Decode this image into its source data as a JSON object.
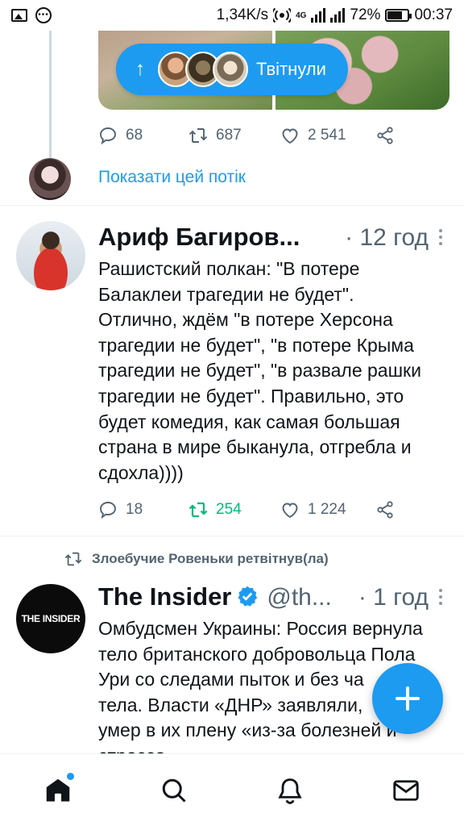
{
  "status_bar": {
    "speed": "1,34K/s",
    "network": "4G",
    "battery": "72%",
    "time": "00:37",
    "icons": [
      "image-icon",
      "more-dots-icon",
      "hotspot-icon",
      "signal-icon",
      "battery-icon"
    ]
  },
  "colors": {
    "accent": "#1d9bf0",
    "retweet_active": "#00ba7c",
    "muted": "#536471",
    "text": "#0f1419"
  },
  "top_tweet": {
    "retweeted_pill_label": "Твітнули",
    "actions": {
      "replies": "68",
      "retweets": "687",
      "likes": "2 541"
    },
    "show_thread": "Показати цей потік"
  },
  "tweet_arif": {
    "name": "Ариф Багиров...",
    "time": "· 12 год",
    "text": "Рашистский полкан: \"В потере\nБалаклеи трагедии не будет\".\nОтлично, ждём \"в потере Херсона\nтрагедии не будет\", \"в потере Крыма\nтрагедии не будет\", \"в развале рашки\nтрагедии не будет\". Правильно, это\nбудет комедия, как самая большая\nстрана в мире быканула, отгребла и\nсдохла))))",
    "actions": {
      "replies": "18",
      "retweets": "254",
      "likes": "1 224"
    }
  },
  "tweet_insider": {
    "retweet_context": "Злоебучие Ровеньки ретвітнув(ла)",
    "avatar_text": "THE INSIDER",
    "name": "The Insider",
    "handle": "@th...",
    "time": "· 1 год",
    "text": "Омбудсмен Украины: Россия вернула\nтело британского добровольца Пола\nУри со следами пыток и без ча\nтела. Власти «ДНР» заявляли,\nумер в их плену «из-за болезней и\nстресса»"
  },
  "bottom_nav": [
    "home-icon",
    "search-icon",
    "notifications-icon",
    "messages-icon"
  ]
}
